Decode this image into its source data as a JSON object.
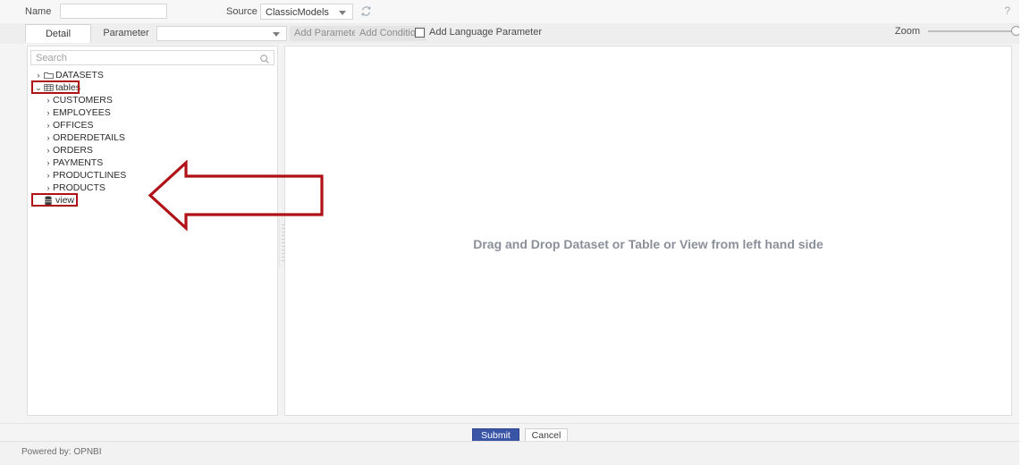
{
  "topbar": {
    "name_label": "Name",
    "name_value": "",
    "name_placeholder": "",
    "source_label": "Source",
    "source_value": "ClassicModels",
    "refresh_icon": "refresh-icon",
    "help_icon": "question-mark-icon"
  },
  "tabrow": {
    "tab_detail": "Detail",
    "tab_parameter": "Parameter",
    "parameter_select_value": "",
    "add_parameter_label": "Add Parameter",
    "add_condition_label": "Add Condition",
    "add_language_parameter_label": "Add Language Parameter",
    "add_language_parameter_checked": false,
    "zoom_label": "Zoom",
    "zoom_value": 100
  },
  "tree_panel": {
    "search_placeholder": "Search",
    "search_value": "",
    "search_icon": "magnifier-icon",
    "nodes": [
      {
        "label": "DATASETS",
        "level": 0,
        "chevron": "›",
        "icon": "folder-icon",
        "highlighted": false
      },
      {
        "label": "tables",
        "level": 0,
        "chevron": "⌄",
        "icon": "table-icon",
        "highlighted": true
      },
      {
        "label": "CUSTOMERS",
        "level": 1,
        "chevron": "›",
        "icon": "",
        "highlighted": false
      },
      {
        "label": "EMPLOYEES",
        "level": 1,
        "chevron": "›",
        "icon": "",
        "highlighted": false
      },
      {
        "label": "OFFICES",
        "level": 1,
        "chevron": "›",
        "icon": "",
        "highlighted": false
      },
      {
        "label": "ORDERDETAILS",
        "level": 1,
        "chevron": "›",
        "icon": "",
        "highlighted": false
      },
      {
        "label": "ORDERS",
        "level": 1,
        "chevron": "›",
        "icon": "",
        "highlighted": false
      },
      {
        "label": "PAYMENTS",
        "level": 1,
        "chevron": "›",
        "icon": "",
        "highlighted": false
      },
      {
        "label": "PRODUCTLINES",
        "level": 1,
        "chevron": "›",
        "icon": "",
        "highlighted": false
      },
      {
        "label": "PRODUCTS",
        "level": 1,
        "chevron": "›",
        "icon": "",
        "highlighted": false
      },
      {
        "label": "view",
        "level": 0,
        "chevron": "",
        "icon": "database-icon",
        "highlighted": true
      }
    ]
  },
  "canvas": {
    "hint": "Drag and Drop Dataset or Table or View from left hand side"
  },
  "annotations": {
    "arrow_icon": "left-arrow-annotation",
    "arrow_color": "#b01116",
    "highlight_color": "#b01116"
  },
  "buttons": {
    "submit": "Submit",
    "cancel": "Cancel"
  },
  "footer": {
    "powered_by": "Powered by: OPNBI"
  },
  "colors": {
    "submit_blue": "#3b55a6",
    "annotation_red": "#b01116",
    "hint_gray": "#8a8f99"
  }
}
